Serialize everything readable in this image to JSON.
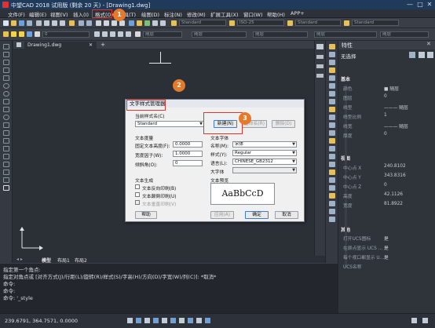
{
  "window": {
    "title": "中望CAD 2018 试用版 (剩余 20 天) - [Drawing1.dwg]",
    "controls": [
      "—",
      "□",
      "✕"
    ]
  },
  "menu": [
    "文件(F)",
    "编辑(E)",
    "视图(V)",
    "插入(I)",
    "格式(O)",
    "工具(T)",
    "绘图(D)",
    "标注(N)",
    "修改(M)",
    "扩展工具(X)",
    "窗口(W)",
    "帮助(H)",
    "APP+"
  ],
  "toolbar": {
    "style_combo_1": "Standard",
    "style_combo_2": "ISO-25",
    "style_combo_3": "Standard",
    "style_combo_4": "Standard",
    "layer_combo": "0",
    "bylayer_1": "随层",
    "bylayer_2": "随层",
    "bylayer_3": "随层",
    "bylayer_4": "随层",
    "bylayer_5": "随层"
  },
  "doc_tab": {
    "label": "Drawing1.dwg",
    "close": "✕"
  },
  "model_tabs": [
    "模型",
    "布局1",
    "布局2"
  ],
  "command": {
    "lines": [
      "指定第一个角点:",
      "指定对角点或 [对齐方式(J)/行距(L)/旋转(R)/样式(S)/字高(H)/方向(D)/字宽(W)/列(C)]: *取消*",
      "命令:",
      "命令:",
      "命令: '_style"
    ]
  },
  "status": {
    "coords": "239.6791, 364.7571, 0.0000"
  },
  "properties": {
    "title": "特性",
    "selection": "无选择",
    "sections": {
      "basic": "基本",
      "view": "视图",
      "misc": "其他"
    },
    "basic_rows": [
      {
        "label": "颜色",
        "value": "■ 随层"
      },
      {
        "label": "图层",
        "value": "0"
      },
      {
        "label": "线型",
        "value": "——— 随层"
      },
      {
        "label": "线型比例",
        "value": "1"
      },
      {
        "label": "线宽",
        "value": "——— 随层"
      },
      {
        "label": "厚度",
        "value": "0"
      }
    ],
    "view_rows": [
      {
        "label": "中心点 X",
        "value": "240.8102"
      },
      {
        "label": "中心点 Y",
        "value": "343.8316"
      },
      {
        "label": "中心点 Z",
        "value": "0"
      },
      {
        "label": "高度",
        "value": "42.1126"
      },
      {
        "label": "宽度",
        "value": "81.8922"
      }
    ],
    "misc_rows": [
      {
        "label": "打开UCS图标",
        "value": "是"
      },
      {
        "label": "在原点显示 UCS ...",
        "value": "是"
      },
      {
        "label": "每个视口都显示 U...",
        "value": "是"
      },
      {
        "label": "UCS名称",
        "value": ""
      }
    ]
  },
  "dialog": {
    "title": "文字样式管理器",
    "current_style_label": "当前样式名(C)",
    "current_style_value": "Standard",
    "btn_new": "新建(N)",
    "btn_rename": "重命名(R)",
    "btn_delete": "删除(D)",
    "metrics_group": "文本度量",
    "height_label": "固定文本高度(F):",
    "height_value": "0.0000",
    "width_label": "宽度因子(W):",
    "width_value": "1.0000",
    "oblique_label": "倾斜角(O):",
    "oblique_value": "0",
    "font_group": "文本字体",
    "font_name_label": "名称(M):",
    "font_name_value": "宋体",
    "font_style_label": "样式(Y):",
    "font_style_value": "Regular",
    "lang_label": "语言(L):",
    "lang_value": "CHINESE_GB2312",
    "bigfont_label": "大字体",
    "gen_group": "文本生成",
    "backwards_label": "文本反向印刷(B)",
    "upside_label": "文本颠倒印刷(U)",
    "vertical_label": "文本垂直印刷(V)",
    "preview_label": "文本预览",
    "preview_text": "AaBbCcD",
    "btn_help": "帮助",
    "btn_apply": "应用(A)",
    "btn_ok": "确定",
    "btn_cancel": "取消"
  },
  "annotations": {
    "step1": "1",
    "step2": "2",
    "step3": "3",
    "accent": "#e57a2b",
    "box_color": "#e0332c"
  }
}
